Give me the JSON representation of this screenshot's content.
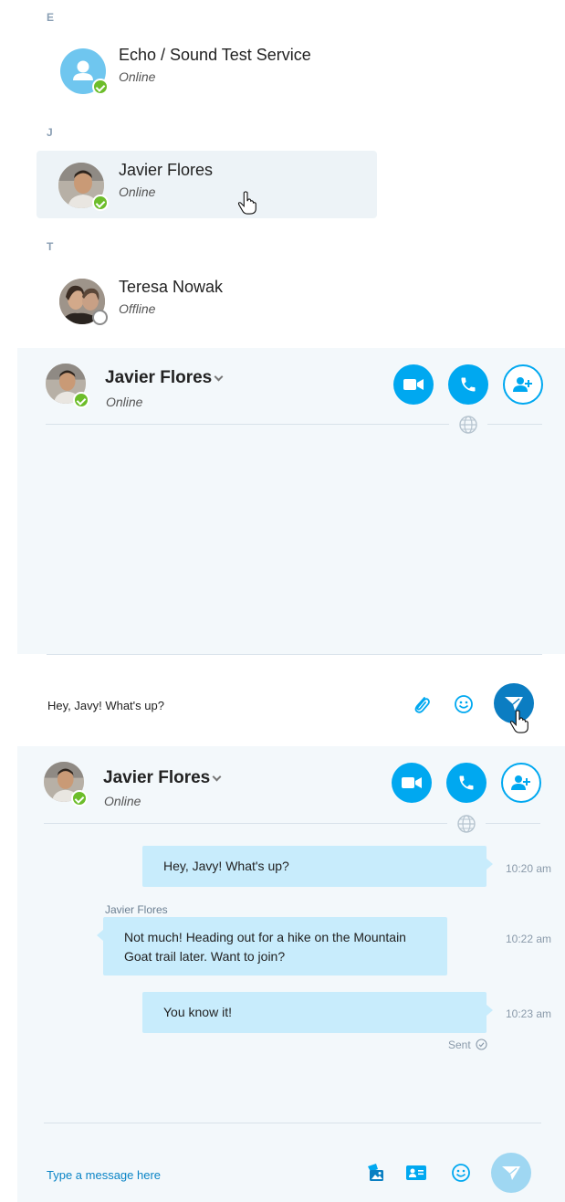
{
  "contacts": {
    "sections": [
      {
        "letter": "E"
      },
      {
        "letter": "J"
      },
      {
        "letter": "T"
      }
    ],
    "items": [
      {
        "name": "Echo / Sound Test Service",
        "status": "Online"
      },
      {
        "name": "Javier Flores",
        "status": "Online"
      },
      {
        "name": "Teresa Nowak",
        "status": "Offline"
      }
    ]
  },
  "chat1": {
    "contact_name": "Javier Flores",
    "contact_status": "Online",
    "compose_text": "Hey, Javy! What's up?"
  },
  "chat2": {
    "contact_name": "Javier Flores",
    "contact_status": "Online",
    "messages": [
      {
        "direction": "outgoing",
        "text": "Hey, Javy! What's up?",
        "time": "10:20 am"
      },
      {
        "direction": "incoming",
        "sender": "Javier Flores",
        "text": "Not much! Heading out for a hike on the Mountain Goat trail later. Want to join?",
        "time": "10:22 am"
      },
      {
        "direction": "outgoing",
        "text": "You know it!",
        "time": "10:23 am",
        "status": "Sent"
      }
    ],
    "compose_placeholder": "Type a message here"
  },
  "icons": {
    "video": "video-camera-icon",
    "call": "phone-icon",
    "add_contact": "add-person-icon",
    "globe": "globe-icon",
    "attach": "paperclip-icon",
    "emoji": "smiley-icon",
    "send": "send-icon",
    "image": "image-share-icon",
    "contact_card": "contact-card-icon",
    "online": "online-check-icon",
    "offline": "offline-ring-icon",
    "cursor": "hand-pointer-icon"
  },
  "colors": {
    "accent": "#00a8f0",
    "online": "#6cbd2a",
    "bubble": "#c8ecfc",
    "panel_bg": "#f3f8fb",
    "send_active": "#0b7dc2",
    "send_inactive": "#9fd7f2"
  }
}
